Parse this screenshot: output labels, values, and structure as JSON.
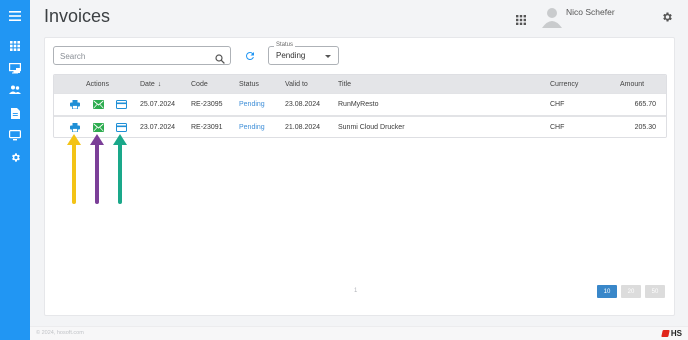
{
  "header": {
    "title": "Invoices",
    "user_name": "Nico Schefer"
  },
  "sidebar": {
    "items": [
      {
        "icon": "menu-icon"
      },
      {
        "icon": "grid-icon"
      },
      {
        "icon": "monitor-icon"
      },
      {
        "icon": "users-icon"
      },
      {
        "icon": "document-icon"
      },
      {
        "icon": "display-icon"
      },
      {
        "icon": "gear-icon"
      }
    ]
  },
  "filters": {
    "search_placeholder": "Search",
    "status_label": "Status",
    "status_value": "Pending"
  },
  "table": {
    "headers": {
      "actions": "Actions",
      "date": "Date",
      "code": "Code",
      "status": "Status",
      "valid_to": "Valid to",
      "title": "Title",
      "currency": "Currency",
      "amount": "Amount"
    },
    "sort_indicator": "↓",
    "rows": [
      {
        "date": "25.07.2024",
        "code": "RE-23095",
        "status": "Pending",
        "valid_to": "23.08.2024",
        "title": "RunMyResto",
        "currency": "CHF",
        "amount": "665.70"
      },
      {
        "date": "23.07.2024",
        "code": "RE-23091",
        "status": "Pending",
        "valid_to": "21.08.2024",
        "title": "Sunmi Cloud Drucker",
        "currency": "CHF",
        "amount": "205.30"
      }
    ],
    "action_icons": [
      "print-icon",
      "email-icon",
      "card-icon"
    ]
  },
  "annotations": {
    "arrow_colors": [
      "#f3c316",
      "#7b3f98",
      "#1aa88a"
    ]
  },
  "pagination": {
    "current_page": "1",
    "page_sizes": [
      "10",
      "20",
      "50"
    ],
    "active_page_size": "10"
  },
  "footer": {
    "copyright": "© 2024, hosoft.com",
    "brand": "HS"
  },
  "colors": {
    "accent": "#2196f3",
    "link": "#3f8fd8",
    "print_icon": "#1f8fd6",
    "email_icon": "#2dac4f",
    "card_icon": "#1f8fd6"
  }
}
